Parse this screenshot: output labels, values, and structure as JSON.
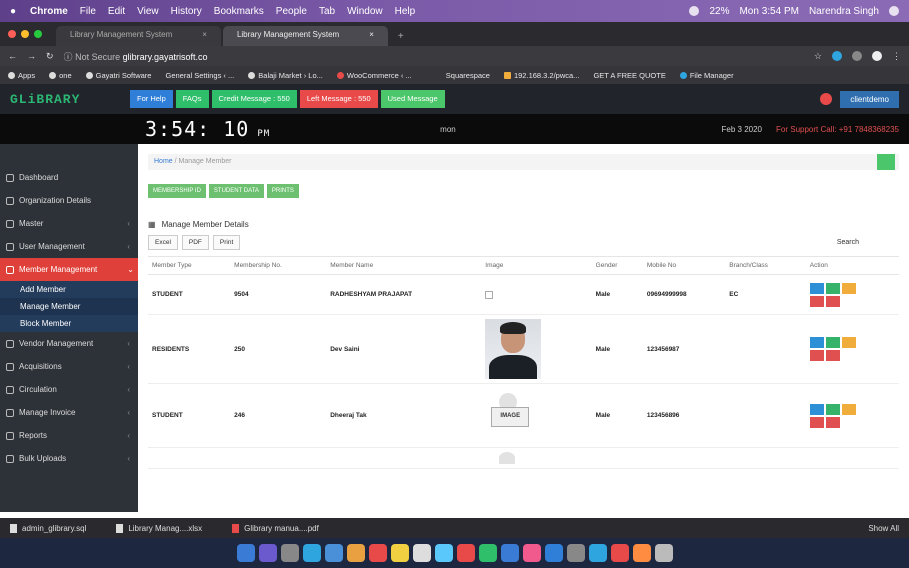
{
  "menubar": {
    "items": [
      "Chrome",
      "File",
      "Edit",
      "View",
      "History",
      "Bookmarks",
      "People",
      "Tab",
      "Window",
      "Help"
    ],
    "battery": "22%",
    "datetime": "Mon 3:54 PM",
    "user": "Narendra Singh"
  },
  "browser": {
    "tabs": [
      {
        "label": "Library Management System"
      },
      {
        "label": "Library Management System"
      }
    ],
    "url_prefix": "Not Secure",
    "url_host": "glibrary.gayatrisoft.co",
    "bookmarks": [
      "Apps",
      "one",
      "Gayatri Software",
      "General Settings ‹ ...",
      "Balaji Market › Lo...",
      "WooCommerce ‹ ...",
      "Squarespace",
      "192.168.3.2/pwca...",
      "GET A FREE QUOTE",
      "File Manager"
    ]
  },
  "header": {
    "logo": "GLiBRARY",
    "buttons": [
      {
        "label": "For Help",
        "color": "#2f7fd8"
      },
      {
        "label": "FAQs",
        "color": "#2fbf6a"
      },
      {
        "label": "Credit Message : 550",
        "color": "#2fbf6a"
      },
      {
        "label": "Left Message : 550",
        "color": "#e84a4a"
      },
      {
        "label": "Used Message",
        "color": "#4cc66a"
      }
    ],
    "user": "clientdemo"
  },
  "clockbar": {
    "time": "3:54: 10",
    "ampm": "PM",
    "mid": "mon",
    "date": "Feb 3 2020",
    "support": "For Support Call: +91 7848368235"
  },
  "sidebar": {
    "items": [
      {
        "label": "Dashboard"
      },
      {
        "label": "Organization Details"
      },
      {
        "label": "Master"
      },
      {
        "label": "User Management"
      },
      {
        "label": "Member Management"
      }
    ],
    "sub_items": [
      "Add Member",
      "Manage Member",
      "Block Member"
    ],
    "items_after": [
      {
        "label": "Vendor Management"
      },
      {
        "label": "Acquisitions"
      },
      {
        "label": "Circulation"
      },
      {
        "label": "Manage Invoice"
      },
      {
        "label": "Reports"
      },
      {
        "label": "Bulk Uploads"
      }
    ]
  },
  "content": {
    "breadcrumb_home": "Home",
    "breadcrumb_current": "Manage Member",
    "pills": [
      "MEMBERSHIP ID",
      "STUDENT DATA",
      "PRINTS"
    ],
    "section_title": "Manage Member Details",
    "exports": [
      "Excel",
      "PDF",
      "Print"
    ],
    "search_label": "Search",
    "columns": [
      "Member Type",
      "Membership No.",
      "Member Name",
      "Image",
      "Gender",
      "Mobile No",
      "Branch/Class",
      "Action"
    ],
    "rows": [
      {
        "type": "STUDENT",
        "no": "9504",
        "name": "RADHESHYAM PRAJAPAT",
        "image": "broken",
        "gender": "Male",
        "mobile": "09694999998",
        "branch": "EC"
      },
      {
        "type": "RESIDENTS",
        "no": "250",
        "name": "Dev Saini",
        "image": "photo",
        "gender": "Male",
        "mobile": "123456987",
        "branch": ""
      },
      {
        "type": "STUDENT",
        "no": "246",
        "name": "Dheeraj Tak",
        "image": "placeholder",
        "gender": "Male",
        "mobile": "123456896",
        "branch": ""
      }
    ],
    "placeholder_text": "IMAGE"
  },
  "downloads": {
    "files": [
      "admin_glibrary.sql",
      "Library Manag....xlsx",
      "Glibrary manua....pdf"
    ],
    "show_all": "Show All"
  }
}
